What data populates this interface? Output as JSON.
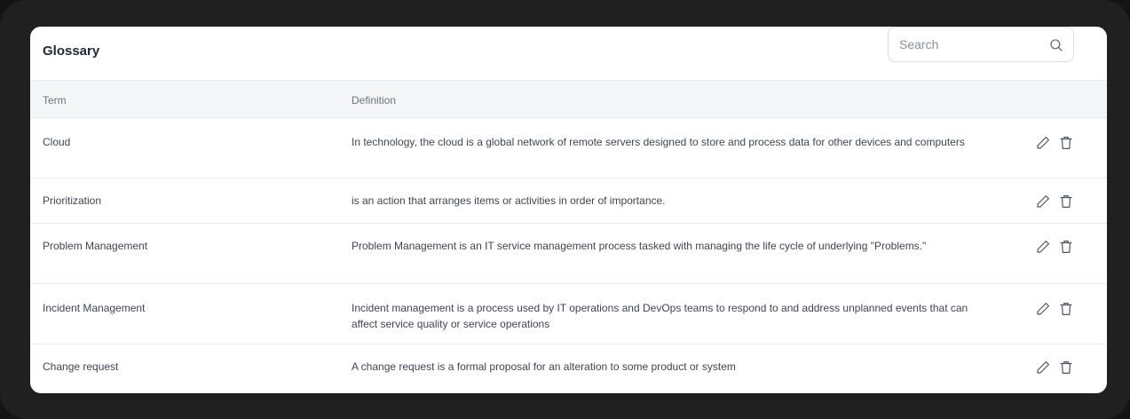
{
  "glossary": {
    "title": "Glossary",
    "search": {
      "placeholder": "Search",
      "value": ""
    },
    "columns": {
      "term": "Term",
      "definition": "Definition"
    },
    "rows": [
      {
        "term": "Cloud",
        "definition": "In technology, the cloud is a global network of remote servers designed to store and process data for other devices and computers"
      },
      {
        "term": "Prioritization",
        "definition": "is an action that arranges items or activities in order of importance."
      },
      {
        "term": "Problem Management",
        "definition": "Problem Management is an IT service management process tasked with managing the life cycle of underlying \"Problems.\""
      },
      {
        "term": "Incident Management",
        "definition": "Incident management is a process used by IT operations and DevOps teams to respond to and address unplanned events that can affect service quality or service operations"
      },
      {
        "term": "Change request",
        "definition": "A change request is a formal proposal for an alteration to some product or system"
      }
    ],
    "icons": {
      "search": "search-icon",
      "edit": "pencil-icon",
      "delete": "trash-icon"
    }
  }
}
